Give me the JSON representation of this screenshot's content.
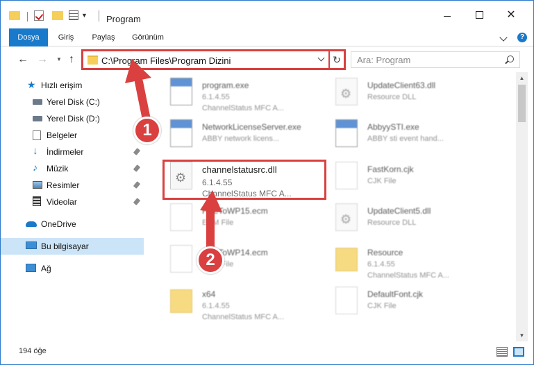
{
  "window": {
    "title": "Program",
    "minimize_label": "",
    "maximize_label": "",
    "close_label": "✕"
  },
  "ribbon": {
    "tabs": [
      {
        "label": "Dosya"
      },
      {
        "label": "Giriş"
      },
      {
        "label": "Paylaş"
      },
      {
        "label": "Görünüm"
      }
    ],
    "help": "?"
  },
  "nav": {
    "back": "←",
    "forward": "→",
    "recent": "▼",
    "up": "↑",
    "address": "C:\\Program Files\\Program Dizini",
    "refresh": "↻",
    "search_placeholder": "Ara: Program"
  },
  "sidebar": {
    "items": [
      {
        "label": "Hızlı erişim",
        "icon": "star-icon"
      },
      {
        "label": "Yerel Disk (C:)",
        "icon": "drive-icon"
      },
      {
        "label": "Yerel Disk (D:)",
        "icon": "drive-icon"
      },
      {
        "label": "Belgeler",
        "icon": "documents-icon"
      },
      {
        "label": "İndirmeler",
        "icon": "download-icon"
      },
      {
        "label": "Müzik",
        "icon": "music-icon"
      },
      {
        "label": "Resimler",
        "icon": "pictures-icon"
      },
      {
        "label": "Videolar",
        "icon": "videos-icon"
      },
      {
        "label": "OneDrive",
        "icon": "cloud-icon"
      },
      {
        "label": "Bu bilgisayar",
        "icon": "computer-icon"
      },
      {
        "label": "Ağ",
        "icon": "network-icon"
      }
    ]
  },
  "files": {
    "left": [
      {
        "name": "program.exe",
        "line1": "6.1.4.55",
        "line2": "ChannelStatus MFC A...",
        "type": "exe"
      },
      {
        "name": "NetworkLicenseServer.exe",
        "line1": "ABBY network licens...",
        "line2": "",
        "type": "exe"
      },
      {
        "name": "channelstatusrc.dll",
        "line1": "6.1.4.55",
        "line2": "ChannelStatus MFC A...",
        "type": "dll"
      },
      {
        "name": "FineToWP15.ecm",
        "line1": "ECM File",
        "line2": "",
        "type": "blank"
      },
      {
        "name": "FineToWP14.ecm",
        "line1": "ECM File",
        "line2": "",
        "type": "blank"
      },
      {
        "name": "x64",
        "line1": "6.1.4.55",
        "line2": "ChannelStatus MFC A...",
        "type": "folder"
      }
    ],
    "right": [
      {
        "name": "UpdateClient63.dll",
        "line1": "Resource DLL",
        "line2": "",
        "type": "dll"
      },
      {
        "name": "AbbyySTI.exe",
        "line1": "ABBY sti event hand...",
        "line2": "",
        "type": "exe"
      },
      {
        "name": "FastKorn.cjk",
        "line1": "CJK File",
        "line2": "",
        "type": "blank"
      },
      {
        "name": "UpdateClient5.dll",
        "line1": "Resource DLL",
        "line2": "",
        "type": "dll"
      },
      {
        "name": "Resource",
        "line1": "6.1.4.55",
        "line2": "ChannelStatus MFC A...",
        "type": "folder"
      },
      {
        "name": "DefaultFont.cjk",
        "line1": "CJK File",
        "line2": "",
        "type": "blank"
      }
    ]
  },
  "status": {
    "count": "194 öğe"
  },
  "annotations": {
    "step1": "1",
    "step2": "2",
    "color": "#d9403f"
  }
}
